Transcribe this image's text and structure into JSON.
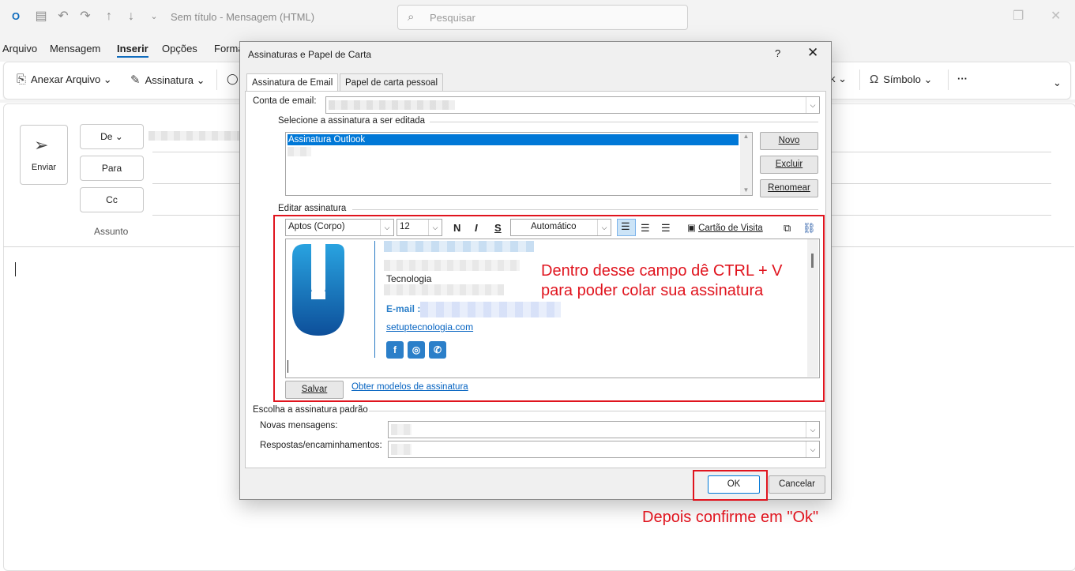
{
  "titlebar": {
    "title": "Sem título  -  Mensagem (HTML)",
    "search_placeholder": "Pesquisar"
  },
  "menu": [
    "Arquivo",
    "Mensagem",
    "Inserir",
    "Opções",
    "Forma"
  ],
  "ribbon": {
    "attach": "Anexar Arquivo",
    "signature": "Assinatura",
    "tk": "k",
    "symbol": "Símbolo",
    "more": "···"
  },
  "compose": {
    "send": "Enviar",
    "from": "De",
    "to": "Para",
    "cc": "Cc",
    "subject": "Assunto"
  },
  "dialog": {
    "title": "Assinaturas e Papel de Carta",
    "help": "?",
    "close": "✕",
    "tabs": [
      "Assinatura de Email",
      "Papel de carta pessoal"
    ],
    "account_label": "Conta de email:",
    "select_label": "Selecione a assinatura a ser editada",
    "selected_signature": "Assinatura Outlook",
    "btn_new": "Novo",
    "btn_delete": "Excluir",
    "btn_rename": "Renomear",
    "edit_label": "Editar assinatura",
    "font": "Aptos (Corpo)",
    "size": "12",
    "bold": "N",
    "italic": "I",
    "underline": "S",
    "color": "Automático",
    "business_card": "Cartão de Visita",
    "sig_company": "Tecnologia",
    "sig_email_label": "E-mail :",
    "sig_website": "setuptecnologia.com",
    "btn_save": "Salvar",
    "templates_link": "Obter modelos de assinatura",
    "default_label": "Escolha a assinatura padrão",
    "new_messages_label": "Novas mensagens:",
    "replies_label": "Respostas/encaminhamentos:",
    "ok": "OK",
    "cancel": "Cancelar"
  },
  "annotations": {
    "paste_hint_line1": "Dentro desse campo dê CTRL + V",
    "paste_hint_line2": "para poder colar sua assinatura",
    "confirm_hint": "Depois confirme em \"Ok\""
  },
  "colors": {
    "accent": "#0f6cbd",
    "annotation_red": "#e0141e",
    "selection": "#0078d7"
  }
}
